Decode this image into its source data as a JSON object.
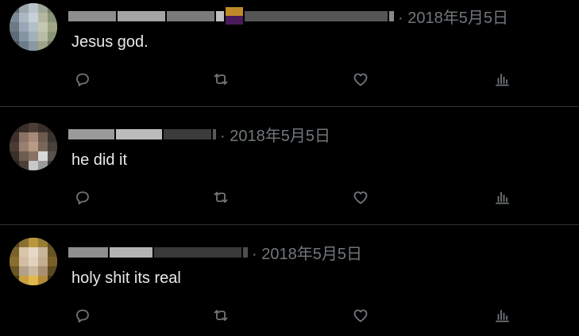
{
  "colors": {
    "background": "#000000",
    "text": "#e7e9ea",
    "muted": "#71767b",
    "divider": "#2f3336"
  },
  "tweets": [
    {
      "date": "· 2018年5月5日",
      "text": "Jesus god.",
      "actions": [
        "reply-icon",
        "retweet-icon",
        "like-icon",
        "views-icon"
      ]
    },
    {
      "date": "· 2018年5月5日",
      "text": "he did it",
      "actions": [
        "reply-icon",
        "retweet-icon",
        "like-icon",
        "views-icon"
      ]
    },
    {
      "date": "· 2018年5月5日",
      "text": "holy shit its real",
      "actions": [
        "reply-icon",
        "retweet-icon",
        "like-icon",
        "views-icon"
      ]
    }
  ]
}
